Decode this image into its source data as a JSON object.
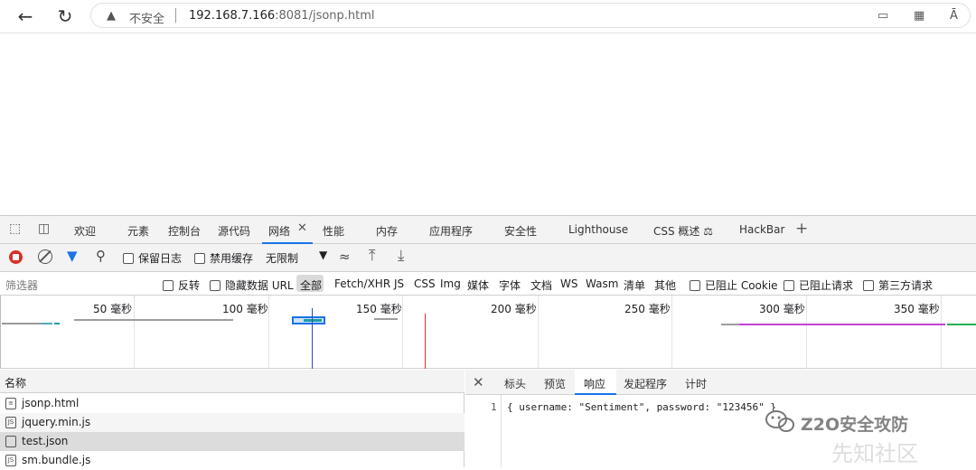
{
  "browser": {
    "security_label": "不安全",
    "url_host": "192.168.7.166",
    "url_rest": ":8081/jsonp.html",
    "read_aloud_label": "Ā"
  },
  "devtools": {
    "tabs": [
      "欢迎",
      "元素",
      "控制台",
      "源代码",
      "网络",
      "性能",
      "内存",
      "应用程序",
      "安全性",
      "Lighthouse",
      "CSS 概述",
      "HackBar"
    ],
    "active_tab": "网络",
    "toolbar": {
      "preserve_log": "保留日志",
      "disable_cache": "禁用缓存",
      "throttle": "无限制"
    },
    "filter": {
      "placeholder": "筛选器",
      "invert": "反转",
      "hide_data_urls": "隐藏数据 URL",
      "types": [
        "全部",
        "Fetch/XHR",
        "JS",
        "CSS",
        "Img",
        "媒体",
        "字体",
        "文档",
        "WS",
        "Wasm",
        "清单",
        "其他"
      ],
      "blocked_cookies": "已阻止 Cookie",
      "blocked_requests": "已阻止请求",
      "third_party": "第三方请求"
    },
    "timeline": {
      "labels": [
        "50 毫秒",
        "100 毫秒",
        "150 毫秒",
        "200 毫秒",
        "250 毫秒",
        "300 毫秒",
        "350 毫秒"
      ]
    },
    "requests": {
      "header": "名称",
      "items": [
        {
          "name": "jsonp.html",
          "selected": false
        },
        {
          "name": "jquery.min.js",
          "selected": false
        },
        {
          "name": "test.json",
          "selected": true
        },
        {
          "name": "sm.bundle.js",
          "selected": false
        }
      ]
    },
    "response": {
      "tabs": [
        "标头",
        "预览",
        "响应",
        "发起程序",
        "计时"
      ],
      "active_tab": "响应",
      "line_number": "1",
      "code": "{ username: \"Sentiment\", password: \"123456\" }"
    }
  },
  "watermark": {
    "line1": "Z2O安全攻防",
    "line2": "先知社区"
  }
}
